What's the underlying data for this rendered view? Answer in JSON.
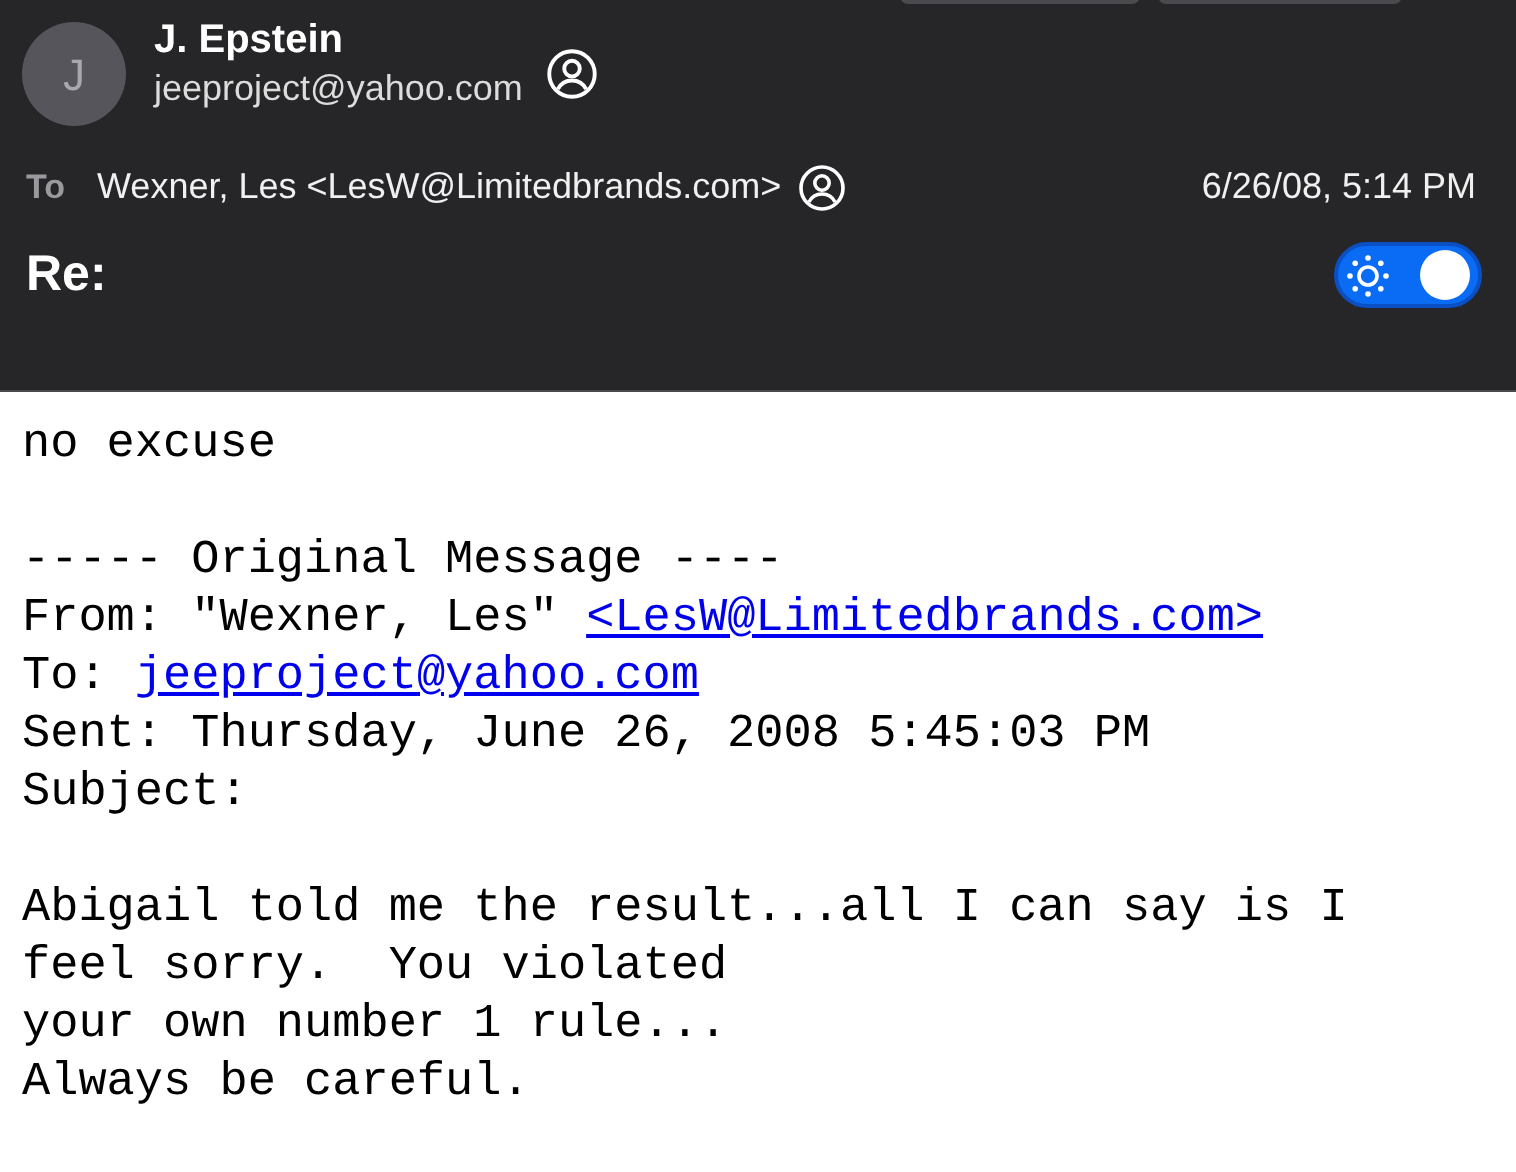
{
  "sender": {
    "initial": "J",
    "name": "J. Epstein",
    "email": "jeeproject@yahoo.com"
  },
  "recipient": {
    "label": "To",
    "name": "Wexner, Les <LesW@Limitedbrands.com>"
  },
  "date": "6/26/08, 5:14 PM",
  "subject": "Re:",
  "light_background_toggle": {
    "on": true
  },
  "body": [
    {
      "kind": "text",
      "text": "no excuse"
    },
    {
      "kind": "blank"
    },
    {
      "kind": "text",
      "text": "----- Original Message ----"
    },
    {
      "kind": "link_line",
      "text": "From: \"Wexner, Les\"",
      "link": "<LesW@Limitedbrands.com>"
    },
    {
      "kind": "link_line",
      "text": "To:",
      "link": "jeeproject@yahoo.com"
    },
    {
      "kind": "text",
      "text": "Sent: Thursday, June 26, 2008 5:45:03 PM"
    },
    {
      "kind": "text",
      "text": "Subject:"
    },
    {
      "kind": "blank"
    },
    {
      "kind": "text",
      "text": "Abigail told me the result...all I can say is I"
    },
    {
      "kind": "text",
      "text": "feel sorry.  You violated"
    },
    {
      "kind": "text",
      "text": "your own number 1 rule..."
    },
    {
      "kind": "text",
      "text": "Always be careful."
    }
  ]
}
